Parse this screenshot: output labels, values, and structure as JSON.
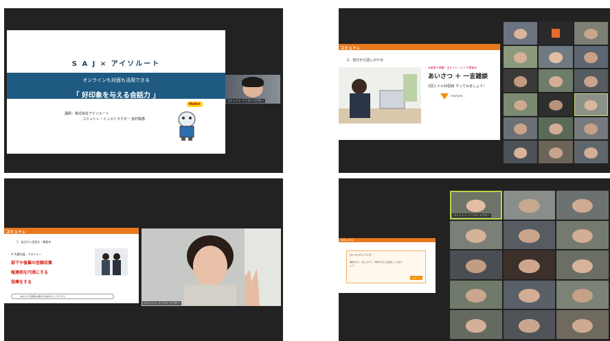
{
  "q1": {
    "title": "S A J × アイソルート",
    "subtitle": "オンラインも対面も活用できる",
    "main_title": "「 好印象を与える会話力 」",
    "presenter_line1": "講師：株式会社アイソルート",
    "presenter_line2": "コミュトレ・インストラクター 前村陽香",
    "hello": "Hello!",
    "speaker_name": "コミュトレ インストラクター"
  },
  "q2": {
    "logo": "コミュトレ",
    "step": "2．自分から話しかける",
    "note": "★研修で体験・またトレーニング実施★",
    "greeting": "あいさつ ＋ 一言雑談",
    "instruction": "1回１人×30回目 やってみましょう！",
    "arrow_label": "example..."
  },
  "q3": {
    "logo": "コミュトレ",
    "step": "1．自分から会話を・雑談を",
    "context": "※ 先輩社員、マネジャー",
    "bullets": [
      "部下や後輩の信頼収集",
      "報連相を円滑にする",
      "指導をする"
    ],
    "footer": "あなたから自発的な働き方を動かすことができる",
    "speaker_name": "コミュトレ インストラクター"
  },
  "q4": {
    "logo": "コミュトレ",
    "box_title": "ロールプレイング",
    "box_text": "課題を元に、話しかけて、印象を与える会話をしてみましょう。",
    "box_button": "スタート",
    "host_name": "コミュトレ インストラクター"
  }
}
